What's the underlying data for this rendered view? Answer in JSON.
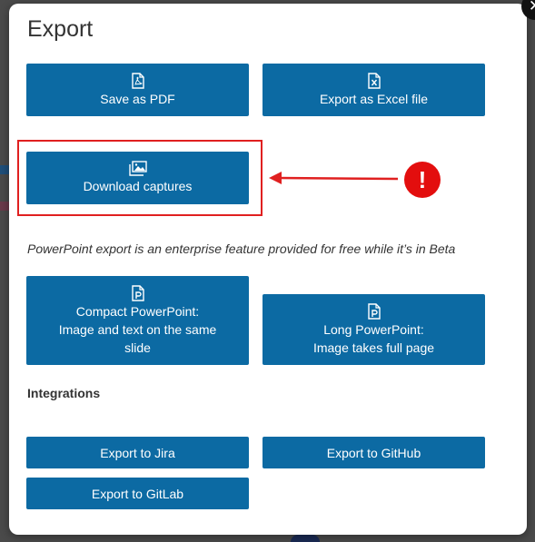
{
  "dialog": {
    "title": "Export",
    "close_symbol": "✕"
  },
  "buttons": {
    "save_pdf": {
      "label": "Save as PDF",
      "icon": "pdf-file-icon"
    },
    "export_excel": {
      "label": "Export as Excel file",
      "icon": "excel-file-icon"
    },
    "download_captures": {
      "label": "Download captures",
      "icon": "images-icon"
    },
    "compact_ppt": {
      "label": "Compact PowerPoint:\nImage and text on the same\nslide",
      "icon": "powerpoint-file-icon"
    },
    "long_ppt": {
      "label": "Long PowerPoint:\nImage takes full page",
      "icon": "powerpoint-file-icon"
    },
    "jira": {
      "label": "Export to Jira"
    },
    "github": {
      "label": "Export to GitHub"
    },
    "gitlab": {
      "label": "Export to GitLab"
    }
  },
  "powerpoint_note": "PowerPoint export is an enterprise feature provided for free while it’s in Beta",
  "integrations_heading": "Integrations",
  "annotation": {
    "alert_symbol": "!",
    "highlight_color": "#e02020"
  },
  "colors": {
    "button_bg": "#0c6aa3",
    "button_text": "#ffffff",
    "overlay": "#4a4a4a"
  }
}
